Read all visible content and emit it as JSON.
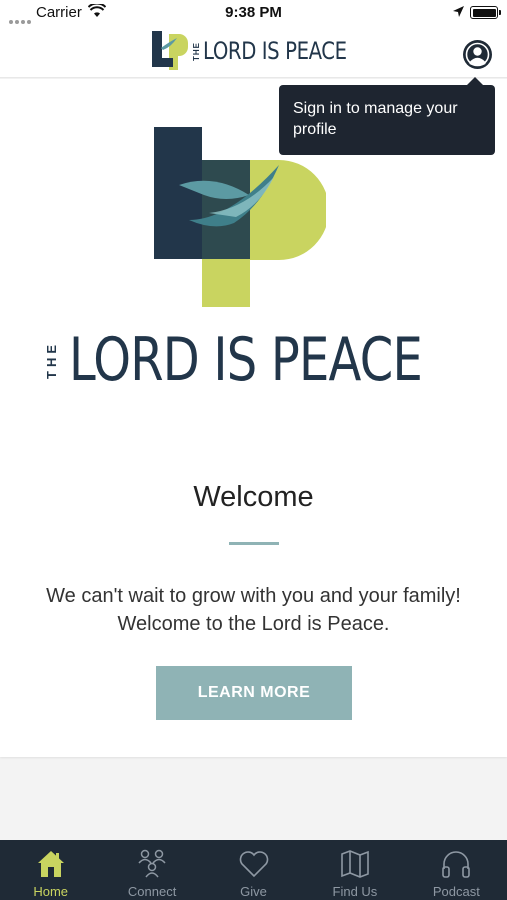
{
  "status_bar": {
    "carrier": "Carrier",
    "time": "9:38 PM"
  },
  "header": {
    "logo_prefix": "THE",
    "logo_text": "LORD IS PEACE",
    "profile_icon": "user-circle-icon"
  },
  "tooltip": {
    "text": "Sign in to manage your profile"
  },
  "hero": {
    "logo_prefix": "THE",
    "logo_text": "LORD IS PEACE"
  },
  "content": {
    "title": "Welcome",
    "message": "We can't wait to grow with you and your family! Welcome to the Lord is Peace.",
    "button_label": "LEARN MORE"
  },
  "tabs": [
    {
      "label": "Home",
      "icon": "home-icon",
      "active": true
    },
    {
      "label": "Connect",
      "icon": "people-icon",
      "active": false
    },
    {
      "label": "Give",
      "icon": "heart-icon",
      "active": false
    },
    {
      "label": "Find Us",
      "icon": "map-icon",
      "active": false
    },
    {
      "label": "Podcast",
      "icon": "headphones-icon",
      "active": false
    }
  ],
  "colors": {
    "navy": "#1f2a36",
    "lime": "#c9d460",
    "teal": "#8fb3b5"
  }
}
